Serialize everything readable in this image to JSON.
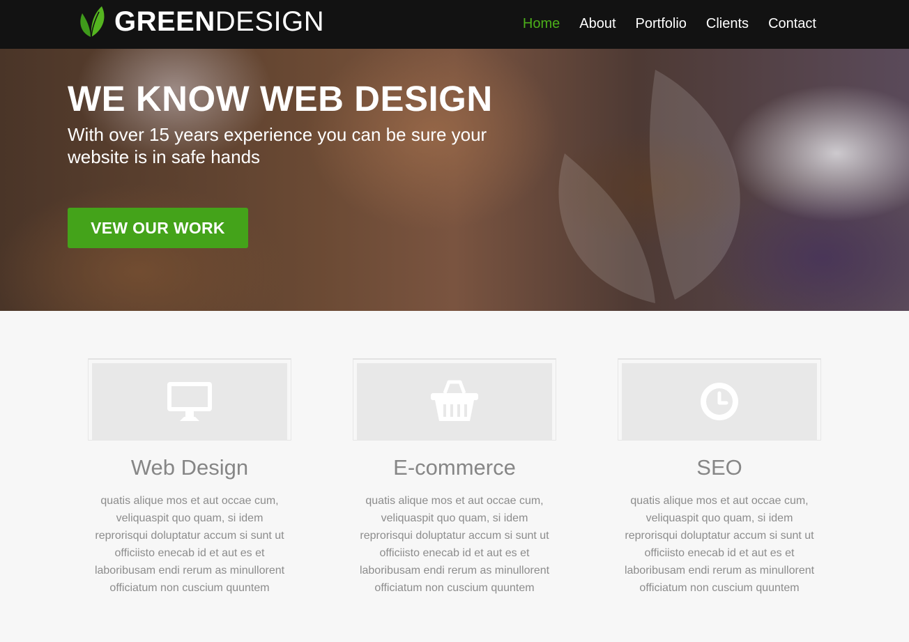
{
  "brand": {
    "name_bold": "GREEN",
    "name_light": "DESIGN",
    "accent_color": "#4caf1a",
    "logo_icon": "leaf-icon"
  },
  "nav": {
    "items": [
      {
        "label": "Home",
        "active": true
      },
      {
        "label": "About",
        "active": false
      },
      {
        "label": "Portfolio",
        "active": false
      },
      {
        "label": "Clients",
        "active": false
      },
      {
        "label": "Contact",
        "active": false
      }
    ]
  },
  "hero": {
    "title": "WE KNOW WEB DESIGN",
    "subtitle": "With over 15 years experience you can be sure your website is in safe hands",
    "cta_label": "VEW OUR WORK",
    "cta_color": "#44a31a"
  },
  "features": [
    {
      "icon": "monitor-icon",
      "title": "Web Design",
      "text": "quatis alique mos et aut occae cum, veliquaspit quo quam, si idem reprorisqui doluptatur accum si sunt ut officiisto enecab id et aut es et laboribusam endi rerum as minullorent officiatum non cuscium quuntem"
    },
    {
      "icon": "basket-icon",
      "title": "E-commerce",
      "text": "quatis alique mos et aut occae cum, veliquaspit quo quam, si idem reprorisqui doluptatur accum si sunt ut officiisto enecab id et aut es et laboribusam endi rerum as minullorent officiatum non cuscium quuntem"
    },
    {
      "icon": "clock-icon",
      "title": "SEO",
      "text": "quatis alique mos et aut occae cum, veliquaspit quo quam, si idem reprorisqui doluptatur accum si sunt ut officiisto enecab id et aut es et laboribusam endi rerum as minullorent officiatum non cuscium quuntem"
    }
  ]
}
